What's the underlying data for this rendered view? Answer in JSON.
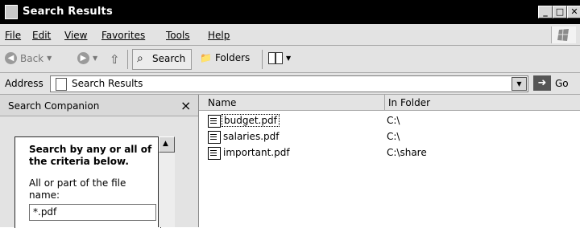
{
  "window": {
    "title": "Search Results"
  },
  "menu": [
    {
      "label": "File",
      "underline_index": 0
    },
    {
      "label": "Edit",
      "underline_index": 0
    },
    {
      "label": "View",
      "underline_index": 0
    },
    {
      "label": "Favorites",
      "underline_index": 1
    },
    {
      "label": "Tools",
      "underline_index": 0
    },
    {
      "label": "Help",
      "underline_index": 0
    }
  ],
  "toolbar": {
    "back_label": "Back",
    "search_label": "Search",
    "folders_label": "Folders"
  },
  "address": {
    "label": "Address",
    "value": "Search Results",
    "go_label": "Go"
  },
  "sidebar": {
    "title": "Search Companion",
    "close_glyph": "×",
    "heading_line1": "Search by any or all of",
    "heading_line2": "the criteria below.",
    "field_label_line1": "All or part of the file",
    "field_label_line2": "name:",
    "filename_value": "*.pdf"
  },
  "columns": {
    "name": "Name",
    "folder": "In Folder"
  },
  "files": [
    {
      "name": "budget.pdf",
      "folder": "C:\\"
    },
    {
      "name": "salaries.pdf",
      "folder": "C:\\"
    },
    {
      "name": "important.pdf",
      "folder": "C:\\share"
    }
  ],
  "colors": {
    "titlebar": "#000000",
    "chrome": "#e3e3e3",
    "content": "#ffffff"
  }
}
